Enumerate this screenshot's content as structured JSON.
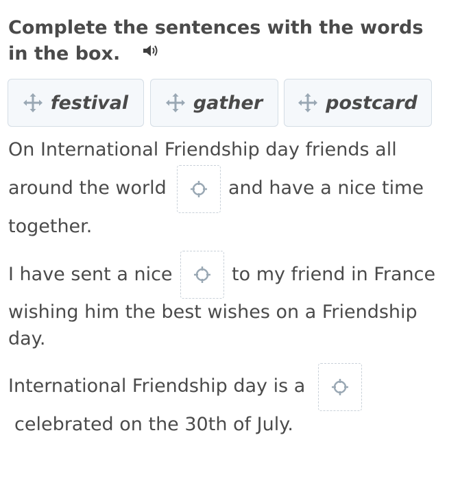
{
  "instructions": {
    "title": "Complete the sentences with the words in the box.",
    "audio_icon": "speaker-icon"
  },
  "word_box": [
    {
      "label": "festival",
      "icon": "move-icon"
    },
    {
      "label": "gather",
      "icon": "move-icon"
    },
    {
      "label": "postcard",
      "icon": "move-icon"
    }
  ],
  "sentences": [
    {
      "line1": "On International Friendship day friends all",
      "before_blank": "around the world",
      "after_blank": "and have a nice time",
      "line3": "together."
    },
    {
      "before_blank": "I have sent a nice",
      "after_blank": "to my friend in France",
      "line2": "wishing him the best wishes on a Friendship",
      "line3": "day."
    },
    {
      "before_blank": "International Friendship day is a",
      "line2": "celebrated on the 30th of July."
    }
  ],
  "colors": {
    "text": "#4a4a4a",
    "chip_bg": "#f5f8fb",
    "chip_border": "#d4dde5",
    "slot_border": "#c8d0d8",
    "icon": "#9aa8b4"
  }
}
